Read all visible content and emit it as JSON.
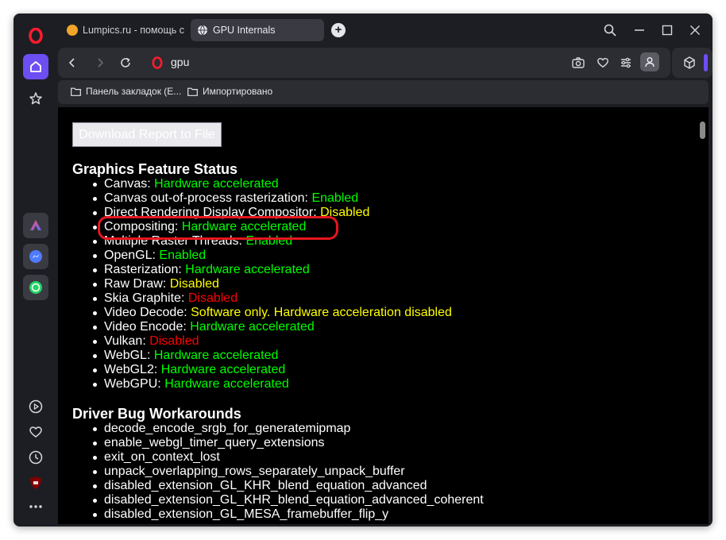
{
  "tabs": [
    {
      "label": "Lumpics.ru - помощь с ко",
      "icon": "lumpics-favicon",
      "active": false
    },
    {
      "label": "GPU Internals",
      "icon": "globe-icon",
      "active": true
    }
  ],
  "address_bar": {
    "url": "gpu"
  },
  "bookmarks": [
    {
      "label": "Панель закладок (E...",
      "icon": "folder-icon"
    },
    {
      "label": "Импортировано",
      "icon": "folder-icon"
    }
  ],
  "page": {
    "download_button": "Download Report to File",
    "feature_status": {
      "heading": "Graphics Feature Status",
      "items": [
        {
          "name": "Canvas:",
          "status": "Hardware accelerated",
          "color": "#00ff00"
        },
        {
          "name": "Canvas out-of-process rasterization:",
          "status": "Enabled",
          "color": "#00ff00"
        },
        {
          "name": "Direct Rendering Display Compositor:",
          "status": "Disabled",
          "color": "#ffff00"
        },
        {
          "name": "Compositing:",
          "status": "Hardware accelerated",
          "color": "#00ff00"
        },
        {
          "name": "Multiple Raster Threads:",
          "status": "Enabled",
          "color": "#00ff00"
        },
        {
          "name": "OpenGL:",
          "status": "Enabled",
          "color": "#00ff00"
        },
        {
          "name": "Rasterization:",
          "status": "Hardware accelerated",
          "color": "#00ff00"
        },
        {
          "name": "Raw Draw:",
          "status": "Disabled",
          "color": "#ffff00"
        },
        {
          "name": "Skia Graphite:",
          "status": "Disabled",
          "color": "#ff0000"
        },
        {
          "name": "Video Decode:",
          "status": "Software only. Hardware acceleration disabled",
          "color": "#ffff00"
        },
        {
          "name": "Video Encode:",
          "status": "Hardware accelerated",
          "color": "#00ff00"
        },
        {
          "name": "Vulkan:",
          "status": "Disabled",
          "color": "#ff0000"
        },
        {
          "name": "WebGL:",
          "status": "Hardware accelerated",
          "color": "#00ff00"
        },
        {
          "name": "WebGL2:",
          "status": "Hardware accelerated",
          "color": "#00ff00"
        },
        {
          "name": "WebGPU:",
          "status": "Hardware accelerated",
          "color": "#00ff00"
        }
      ]
    },
    "workarounds": {
      "heading": "Driver Bug Workarounds",
      "items": [
        "decode_encode_srgb_for_generatemipmap",
        "enable_webgl_timer_query_extensions",
        "exit_on_context_lost",
        "unpack_overlapping_rows_separately_unpack_buffer",
        "disabled_extension_GL_KHR_blend_equation_advanced",
        "disabled_extension_GL_KHR_blend_equation_advanced_coherent",
        "disabled_extension_GL_MESA_framebuffer_flip_y"
      ]
    }
  },
  "colors": {
    "accent": "#6c4ef2",
    "highlight": "#e5161e",
    "opera_red": "#ff1b2d"
  }
}
